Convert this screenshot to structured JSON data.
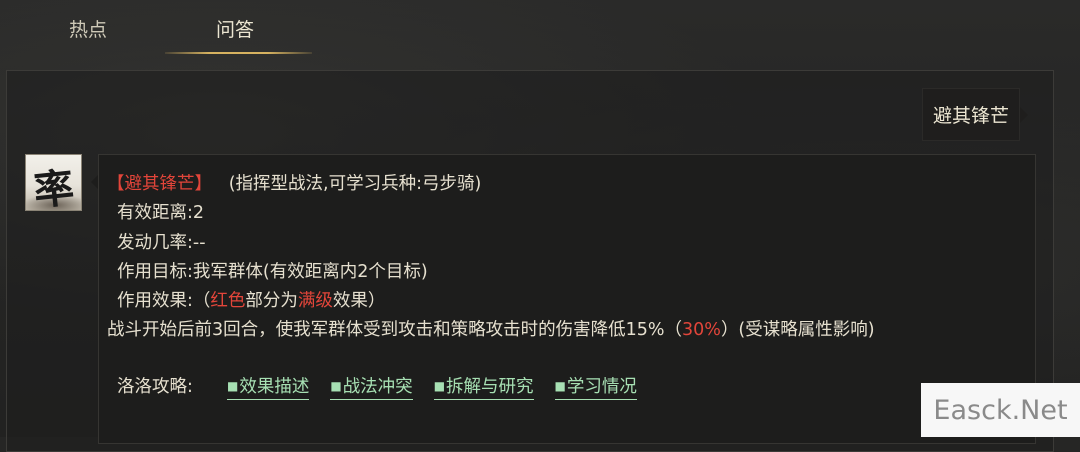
{
  "tabs": {
    "hot": "热点",
    "qa": "问答"
  },
  "question": {
    "text": "避其锋芒"
  },
  "avatar": {
    "glyph": "率"
  },
  "answer": {
    "title": "【避其锋芒】",
    "type_desc": "(指挥型战法,可学习兵种:弓步骑)",
    "range": "有效距离:2",
    "rate": "发动几率:--",
    "target": "作用目标:我军群体(有效距离内2个目标)",
    "effect_prefix": "作用效果:（",
    "effect_red1": "红色",
    "effect_mid": "部分为",
    "effect_red2": "满级",
    "effect_suffix": "效果）",
    "desc_prefix": "战斗开始后前3回合，使我军群体受到攻击和策略攻击时的伤害降低15%（",
    "desc_red": "30%",
    "desc_suffix": "）(受谋略属性影响)",
    "guide_label": "洛洛攻略:",
    "links": [
      "效果描述",
      "战法冲突",
      "拆解与研究",
      "学习情况"
    ],
    "link_marker": "■"
  },
  "watermark": {
    "text": "Easck.Net"
  },
  "colors": {
    "accent_gold": "#d6b260",
    "highlight_red": "#e2453a",
    "link_green": "#a7e0b3"
  }
}
